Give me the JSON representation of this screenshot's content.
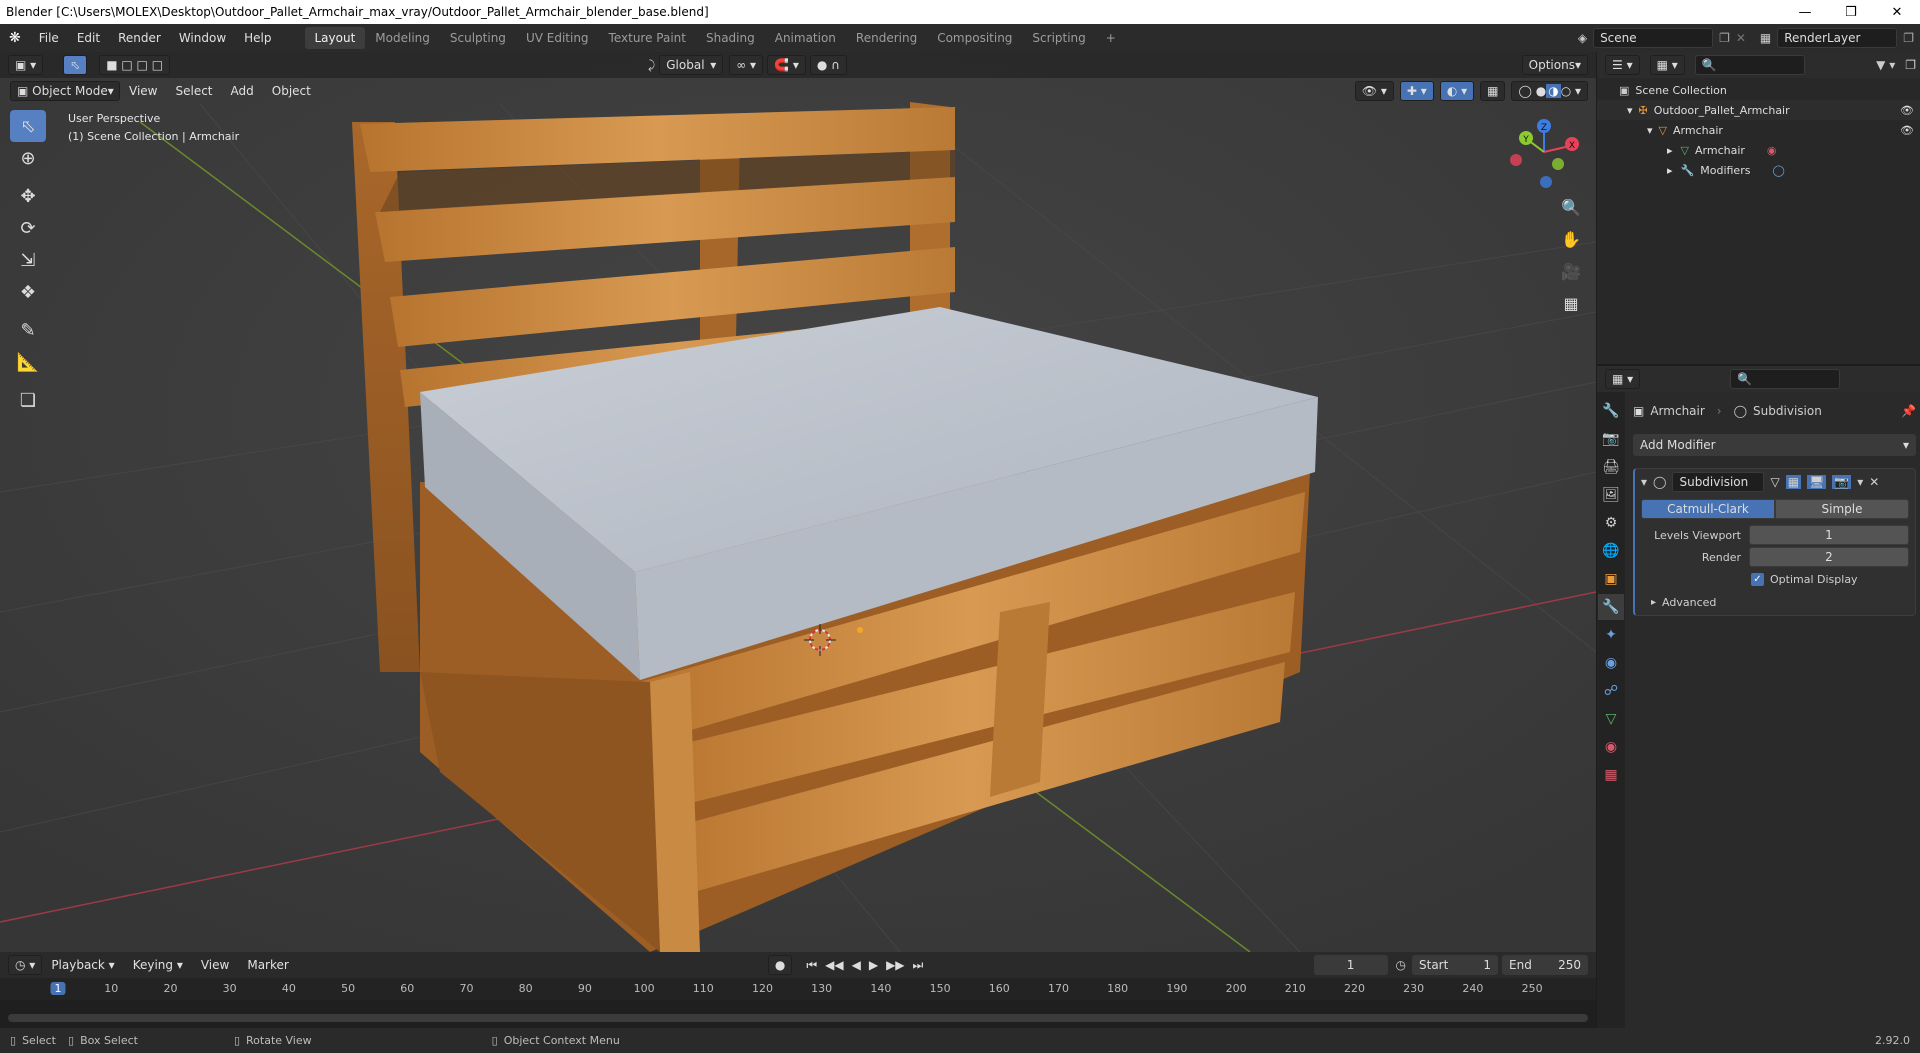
{
  "window": {
    "title": "Blender [C:\\Users\\MOLEX\\Desktop\\Outdoor_Pallet_Armchair_max_vray/Outdoor_Pallet_Armchair_blender_base.blend]",
    "controls": [
      "—",
      "❒",
      "✕"
    ]
  },
  "menu": {
    "items": [
      "File",
      "Edit",
      "Render",
      "Window",
      "Help"
    ],
    "workspaces": [
      "Layout",
      "Modeling",
      "Sculpting",
      "UV Editing",
      "Texture Paint",
      "Shading",
      "Animation",
      "Rendering",
      "Compositing",
      "Scripting"
    ],
    "add_workspace": "+",
    "scene": "Scene",
    "render_layer": "RenderLayer"
  },
  "viewport": {
    "mode": "Object Mode",
    "menus": [
      "View",
      "Select",
      "Add",
      "Object"
    ],
    "transform_orientation": "Global",
    "options_label": "Options",
    "info_line1": "User Perspective",
    "info_line2": "(1) Scene Collection | Armchair",
    "gizmo": {
      "z": "Z",
      "y": "Y",
      "x": "X"
    }
  },
  "tools": [
    "select-box",
    "cursor",
    "move",
    "rotate",
    "scale",
    "transform",
    "annotate",
    "measure",
    "add-cube"
  ],
  "timeline": {
    "menus": [
      "Playback",
      "Keying",
      "View",
      "Marker"
    ],
    "current_frame": "1",
    "start_label": "Start",
    "start_value": "1",
    "end_label": "End",
    "end_value": "250",
    "ruler": [
      "1",
      "10",
      "20",
      "30",
      "40",
      "50",
      "60",
      "70",
      "80",
      "90",
      "100",
      "110",
      "120",
      "130",
      "140",
      "150",
      "160",
      "170",
      "180",
      "190",
      "200",
      "210",
      "220",
      "230",
      "240",
      "250"
    ]
  },
  "status": {
    "select": "Select",
    "box_select": "Box Select",
    "rotate_view": "Rotate View",
    "context_menu": "Object Context Menu",
    "version": "2.92.0"
  },
  "outliner": {
    "root": "Scene Collection",
    "collection": "Outdoor_Pallet_Armchair",
    "object": "Armchair",
    "mesh": "Armchair",
    "modifiers": "Modifiers"
  },
  "properties": {
    "breadcrumb_object": "Armchair",
    "breadcrumb_modifier": "Subdivision",
    "add_modifier": "Add Modifier",
    "modifier_name": "Subdivision",
    "tab_catmull": "Catmull-Clark",
    "tab_simple": "Simple",
    "levels_label": "Levels Viewport",
    "levels_value": "1",
    "render_label": "Render",
    "render_value": "2",
    "optimal_display": "Optimal Display",
    "advanced": "Advanced"
  },
  "colors": {
    "accent": "#4772b3",
    "wood": "#c9853f",
    "cushion": "#bcc3cc",
    "axis_x": "#e8425a",
    "axis_y": "#8ccb2f",
    "axis_z": "#3d7ce0"
  }
}
